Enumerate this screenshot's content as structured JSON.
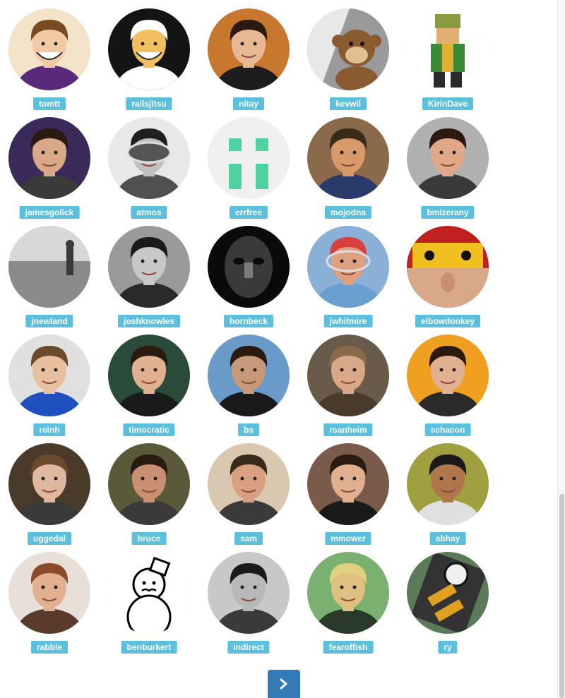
{
  "members": [
    {
      "username": "tomtt",
      "avatar_bg": "#f3e3c9",
      "skin": "#f2c9a5",
      "hair": "#7a4a22",
      "shirt": "#5a2a7a",
      "style": "caricature"
    },
    {
      "username": "railsjitsu",
      "avatar_bg": "#141414",
      "skin": "#f0c060",
      "hair": "#ffffff",
      "shirt": "#ffffff",
      "style": "cartoon"
    },
    {
      "username": "nitay",
      "avatar_bg": "#c8782e",
      "skin": "#e8b894",
      "hair": "#2a1a12",
      "shirt": "#1c1c1c",
      "style": "photo"
    },
    {
      "username": "kevwil",
      "avatar_bg": "#9a9a9a",
      "skin": "#8a5a30",
      "hair": "#6a4020",
      "shirt": "#e8e8e8",
      "style": "monkey"
    },
    {
      "username": "KirinDave",
      "avatar_bg": "#ffffff",
      "skin": "#e0b070",
      "hair": "#8a9a40",
      "shirt": "#3a8a3a",
      "style": "pixel"
    },
    {
      "username": "jamesgolick",
      "avatar_bg": "#3a2a5a",
      "skin": "#d8a888",
      "hair": "#2a1a10",
      "shirt": "#3a3a3a",
      "style": "photo"
    },
    {
      "username": "atmos",
      "avatar_bg": "#e8e8e8",
      "skin": "#c0c0c0",
      "hair": "#202020",
      "shirt": "#505050",
      "style": "goggles"
    },
    {
      "username": "errfree",
      "avatar_bg": "#f0f0f0",
      "skin": "#4fd1a1",
      "hair": "#4fd1a1",
      "shirt": "#4fd1a1",
      "style": "identicon"
    },
    {
      "username": "mojodna",
      "avatar_bg": "#8a6a4a",
      "skin": "#d89a6a",
      "hair": "#3a2a1a",
      "shirt": "#2a3a6a",
      "style": "photo"
    },
    {
      "username": "bmizerany",
      "avatar_bg": "#b0b0b0",
      "skin": "#e0a888",
      "hair": "#2a1a10",
      "shirt": "#3a3a3a",
      "style": "photo"
    },
    {
      "username": "jnewland",
      "avatar_bg": "#bdbdbd",
      "skin": "#7a7a7a",
      "hair": "#3a3a3a",
      "shirt": "#5a5a5a",
      "style": "beach"
    },
    {
      "username": "joshknowles",
      "avatar_bg": "#9a9a9a",
      "skin": "#c8c8c8",
      "hair": "#1a1a1a",
      "shirt": "#2a2a2a",
      "style": "photo"
    },
    {
      "username": "hornbeck",
      "avatar_bg": "#0a0a0a",
      "skin": "#7a7a7a",
      "hair": "#0a0a0a",
      "shirt": "#0a0a0a",
      "style": "dark"
    },
    {
      "username": "jwhitmire",
      "avatar_bg": "#8ab0d8",
      "skin": "#e0a080",
      "hair": "#d84040",
      "shirt": "#6aa0d0",
      "style": "racket"
    },
    {
      "username": "elbowdonkey",
      "avatar_bg": "#c02020",
      "skin": "#d8a888",
      "hair": "#f0c020",
      "shirt": "#7a3a20",
      "style": "lego"
    },
    {
      "username": "reinh",
      "avatar_bg": "#e0e0e0",
      "skin": "#e8c0a0",
      "hair": "#6a4a2a",
      "shirt": "#2050c0",
      "style": "photo"
    },
    {
      "username": "timocratic",
      "avatar_bg": "#2a4a3a",
      "skin": "#e0b090",
      "hair": "#2a1a10",
      "shirt": "#1a1a1a",
      "style": "photo"
    },
    {
      "username": "bs",
      "avatar_bg": "#6a9ac8",
      "skin": "#c8987a",
      "hair": "#2a1a10",
      "shirt": "#1a1a1a",
      "style": "photo"
    },
    {
      "username": "rsanheim",
      "avatar_bg": "#6a5a4a",
      "skin": "#d8a888",
      "hair": "#8a6a4a",
      "shirt": "#4a3a2a",
      "style": "photo"
    },
    {
      "username": "schacon",
      "avatar_bg": "#f0a020",
      "skin": "#e0b090",
      "hair": "#2a1a10",
      "shirt": "#2a2a2a",
      "style": "photo"
    },
    {
      "username": "uggedal",
      "avatar_bg": "#4a3a2a",
      "skin": "#e0b8a0",
      "hair": "#6a4a2a",
      "shirt": "#3a3a3a",
      "style": "photo"
    },
    {
      "username": "bruce",
      "avatar_bg": "#5a5a3a",
      "skin": "#c89070",
      "hair": "#2a1a10",
      "shirt": "#3a3a3a",
      "style": "photo"
    },
    {
      "username": "sam",
      "avatar_bg": "#d8c8b0",
      "skin": "#d8a080",
      "hair": "#3a2a1a",
      "shirt": "#3a3a3a",
      "style": "photo"
    },
    {
      "username": "mmower",
      "avatar_bg": "#7a5a4a",
      "skin": "#e0b090",
      "hair": "#2a1a10",
      "shirt": "#1a1a1a",
      "style": "photo"
    },
    {
      "username": "abhay",
      "avatar_bg": "#a0a040",
      "skin": "#b0784a",
      "hair": "#1a1a1a",
      "shirt": "#e0e0e0",
      "style": "photo"
    },
    {
      "username": "rabble",
      "avatar_bg": "#e8e0d8",
      "skin": "#e0b090",
      "hair": "#8a4a2a",
      "shirt": "#5a3a2a",
      "style": "photo"
    },
    {
      "username": "benburkert",
      "avatar_bg": "#ffffff",
      "skin": "#ffffff",
      "hair": "#000000",
      "shirt": "#ffffff",
      "style": "snowman"
    },
    {
      "username": "indirect",
      "avatar_bg": "#c8c8c8",
      "skin": "#b8b8b8",
      "hair": "#1a1a1a",
      "shirt": "#3a3a3a",
      "style": "photo"
    },
    {
      "username": "fearoffish",
      "avatar_bg": "#7ab070",
      "skin": "#e0c080",
      "hair": "#e0d080",
      "shirt": "#2a3a2a",
      "style": "photo"
    },
    {
      "username": "ry",
      "avatar_bg": "#5a7a5a",
      "skin": "#f0f0f0",
      "hair": "#e0a020",
      "shirt": "#1a1a1a",
      "style": "robot"
    }
  ],
  "pagination": {
    "next_icon": "chevron-right-icon"
  }
}
